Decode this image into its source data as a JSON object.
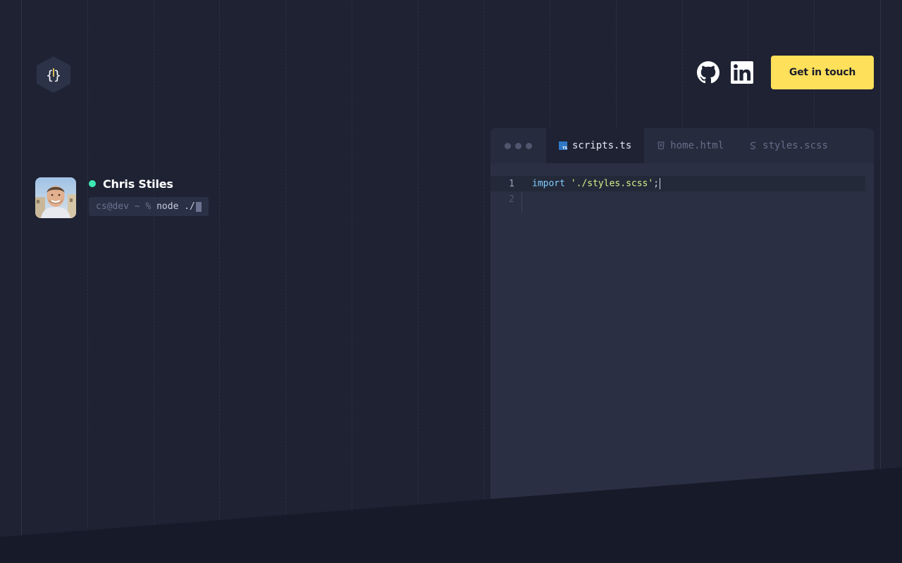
{
  "header": {
    "logo_icon": "curly-braces-hexagon-icon",
    "social": [
      {
        "name": "GitHub",
        "icon": "github-icon"
      },
      {
        "name": "LinkedIn",
        "icon": "linkedin-icon"
      }
    ],
    "cta_label": "Get in touch",
    "cta_color": "#ffe05a"
  },
  "profile": {
    "name": "Chris Stiles",
    "status_color": "#3ee6b3",
    "terminal": {
      "prompt": "cs@dev ~ % ",
      "command": "node ./"
    }
  },
  "editor": {
    "tabs": [
      {
        "label": "scripts.ts",
        "icon": "typescript-file-icon",
        "active": true
      },
      {
        "label": "home.html",
        "icon": "html-file-icon",
        "active": false
      },
      {
        "label": "styles.scss",
        "icon": "sass-file-icon",
        "active": false
      }
    ],
    "lines": [
      {
        "number": "1",
        "keyword": "import",
        "string": "'./styles.scss'",
        "punct": ";"
      },
      {
        "number": "2"
      }
    ]
  },
  "colors": {
    "background": "#1e2233",
    "editor_bg": "#2a2f44",
    "bottom_band": "#171a28"
  }
}
